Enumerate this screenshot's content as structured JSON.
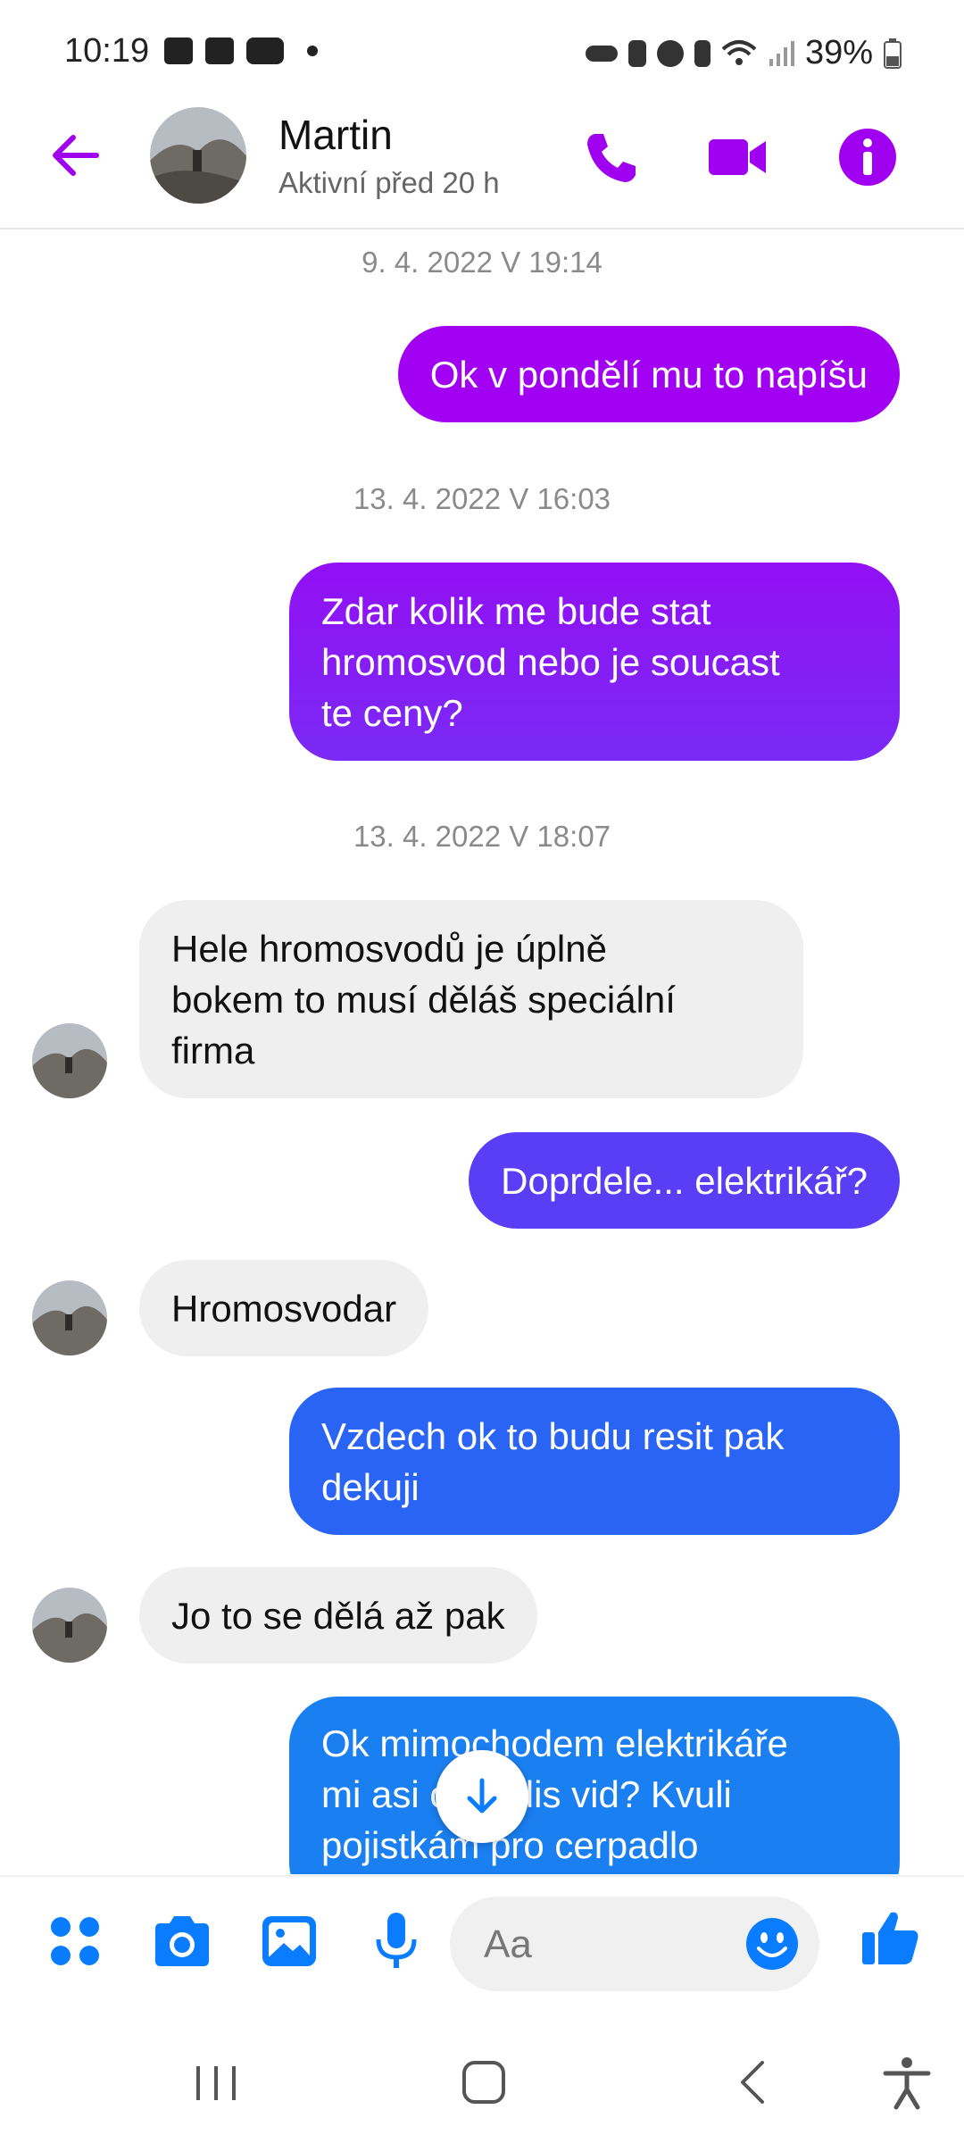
{
  "status_bar": {
    "time": "10:19",
    "battery": "39%",
    "left_icons": [
      "gallery-icon",
      "device-icon",
      "youtube-icon"
    ],
    "right_icons": [
      "key-icon",
      "battery-saver-icon",
      "alarm-icon",
      "bluetooth-icon",
      "wifi-icon",
      "signal-icon"
    ]
  },
  "header": {
    "name": "Martin",
    "status": "Aktivní před 20 h"
  },
  "colors": {
    "accent": "#a000f0",
    "bubble_gradient": [
      "#a100f2",
      "#8a1cf5",
      "#5b3df5",
      "#3a5cf5",
      "#2a6df5",
      "#1e7ef2"
    ],
    "incoming_bubble": "#efefef",
    "composer_blue": "#0a7cff"
  },
  "messages": [
    {
      "type": "timestamp",
      "text": "9. 4. 2022 V 19:14"
    },
    {
      "type": "out",
      "text": "Ok v pondělí mu to napíšu"
    },
    {
      "type": "timestamp",
      "text": "13. 4. 2022 V 16:03"
    },
    {
      "type": "out",
      "lines": [
        "Zdar kolik me bude stat",
        "hromosvod nebo je soucast",
        "te ceny?"
      ]
    },
    {
      "type": "timestamp",
      "text": "13. 4. 2022 V 18:07"
    },
    {
      "type": "in",
      "lines": [
        "Hele hromosvodů je úplně",
        "bokem to musí děláš speciální",
        "firma"
      ]
    },
    {
      "type": "out",
      "text": "Doprdele... elektrikář?"
    },
    {
      "type": "in",
      "text": "Hromosvodar"
    },
    {
      "type": "out",
      "lines": [
        "Vzdech ok to budu resit pak",
        "dekuji"
      ]
    },
    {
      "type": "in",
      "text": "Jo to se dělá až pak"
    },
    {
      "type": "out",
      "lines": [
        "Ok mimochodem elektrikáře",
        "mi asi obhodis vid? Kvuli",
        "pojistkám pro cerpadlo"
      ]
    }
  ],
  "composer": {
    "placeholder": "Aa"
  }
}
